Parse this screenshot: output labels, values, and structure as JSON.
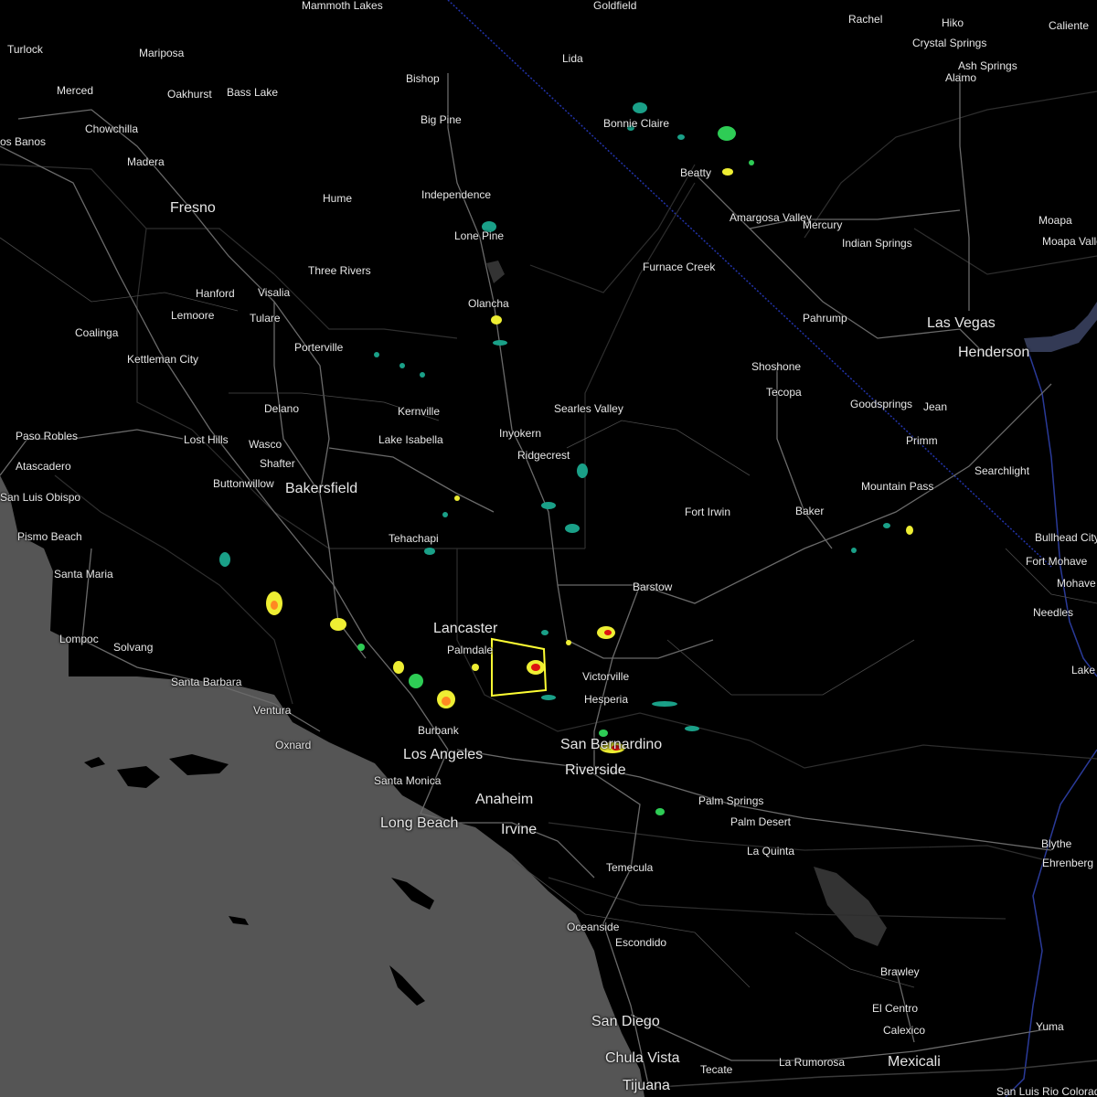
{
  "map": {
    "colors": {
      "land": "#000000",
      "ocean": "#555555",
      "roads": "#6e6e6e",
      "borders": "#3a3a3a",
      "state_line": "#2233aa",
      "water": "#333a55",
      "warning_polygon": "#ffff33",
      "radar_light": "#1aa088",
      "radar_mid": "#2ecc55",
      "radar_yellow": "#eeee33",
      "radar_orange": "#ff8822",
      "radar_red": "#dd1111"
    },
    "cities": [
      {
        "id": "turlock",
        "name": "Turlock"
      },
      {
        "id": "merced",
        "name": "Merced"
      },
      {
        "id": "mariposa",
        "name": "Mariposa"
      },
      {
        "id": "oakhurst",
        "name": "Oakhurst"
      },
      {
        "id": "bass-lake",
        "name": "Bass Lake"
      },
      {
        "id": "chowchilla",
        "name": "Chowchilla"
      },
      {
        "id": "los-banos",
        "name": "os Banos"
      },
      {
        "id": "madera",
        "name": "Madera"
      },
      {
        "id": "fresno",
        "name": "Fresno"
      },
      {
        "id": "hanford",
        "name": "Hanford"
      },
      {
        "id": "lemoore",
        "name": "Lemoore"
      },
      {
        "id": "visalia",
        "name": "Visalia"
      },
      {
        "id": "tulare",
        "name": "Tulare"
      },
      {
        "id": "coalinga",
        "name": "Coalinga"
      },
      {
        "id": "kettleman-city",
        "name": "Kettleman City"
      },
      {
        "id": "porterville",
        "name": "Porterville"
      },
      {
        "id": "three-rivers",
        "name": "Three Rivers"
      },
      {
        "id": "hume",
        "name": "Hume"
      },
      {
        "id": "delano",
        "name": "Delano"
      },
      {
        "id": "paso-robles",
        "name": "Paso Robles"
      },
      {
        "id": "lost-hills",
        "name": "Lost Hills"
      },
      {
        "id": "wasco",
        "name": "Wasco"
      },
      {
        "id": "shafter",
        "name": "Shafter"
      },
      {
        "id": "atascadero",
        "name": "Atascadero"
      },
      {
        "id": "buttonwillow",
        "name": "Buttonwillow"
      },
      {
        "id": "bakersfield",
        "name": "Bakersfield"
      },
      {
        "id": "san-luis-obispo",
        "name": "San Luis Obispo"
      },
      {
        "id": "pismo-beach",
        "name": "Pismo Beach"
      },
      {
        "id": "santa-maria",
        "name": "Santa Maria"
      },
      {
        "id": "lompoc",
        "name": "Lompoc"
      },
      {
        "id": "solvang",
        "name": "Solvang"
      },
      {
        "id": "santa-barbara",
        "name": "Santa Barbara"
      },
      {
        "id": "ventura",
        "name": "Ventura"
      },
      {
        "id": "oxnard",
        "name": "Oxnard"
      },
      {
        "id": "mammoth-lakes",
        "name": "Mammoth Lakes"
      },
      {
        "id": "bishop",
        "name": "Bishop"
      },
      {
        "id": "big-pine",
        "name": "Big Pine"
      },
      {
        "id": "independence",
        "name": "Independence"
      },
      {
        "id": "lone-pine",
        "name": "Lone Pine"
      },
      {
        "id": "olancha",
        "name": "Olancha"
      },
      {
        "id": "kernville",
        "name": "Kernville"
      },
      {
        "id": "lake-isabella",
        "name": "Lake Isabella"
      },
      {
        "id": "inyokern",
        "name": "Inyokern"
      },
      {
        "id": "ridgecrest",
        "name": "Ridgecrest"
      },
      {
        "id": "searles-valley",
        "name": "Searles Valley"
      },
      {
        "id": "tehachapi",
        "name": "Tehachapi"
      },
      {
        "id": "lancaster",
        "name": "Lancaster"
      },
      {
        "id": "palmdale",
        "name": "Palmdale"
      },
      {
        "id": "burbank",
        "name": "Burbank"
      },
      {
        "id": "los-angeles",
        "name": "Los Angeles"
      },
      {
        "id": "santa-monica",
        "name": "Santa Monica"
      },
      {
        "id": "long-beach",
        "name": "Long Beach"
      },
      {
        "id": "anaheim",
        "name": "Anaheim"
      },
      {
        "id": "irvine",
        "name": "Irvine"
      },
      {
        "id": "goldfield",
        "name": "Goldfield"
      },
      {
        "id": "lida",
        "name": "Lida"
      },
      {
        "id": "rachel",
        "name": "Rachel"
      },
      {
        "id": "hiko",
        "name": "Hiko"
      },
      {
        "id": "caliente",
        "name": "Caliente"
      },
      {
        "id": "crystal-springs",
        "name": "Crystal Springs"
      },
      {
        "id": "ash-springs",
        "name": "Ash Springs"
      },
      {
        "id": "alamo",
        "name": "Alamo"
      },
      {
        "id": "bonnie-claire",
        "name": "Bonnie Claire"
      },
      {
        "id": "beatty",
        "name": "Beatty"
      },
      {
        "id": "amargosa-valley",
        "name": "Amargosa Valley"
      },
      {
        "id": "mercury",
        "name": "Mercury"
      },
      {
        "id": "indian-springs",
        "name": "Indian Springs"
      },
      {
        "id": "moapa",
        "name": "Moapa"
      },
      {
        "id": "moapa-valley",
        "name": "Moapa Valley"
      },
      {
        "id": "furnace-creek",
        "name": "Furnace Creek"
      },
      {
        "id": "pahrump",
        "name": "Pahrump"
      },
      {
        "id": "las-vegas",
        "name": "Las Vegas"
      },
      {
        "id": "henderson",
        "name": "Henderson"
      },
      {
        "id": "shoshone",
        "name": "Shoshone"
      },
      {
        "id": "tecopa",
        "name": "Tecopa"
      },
      {
        "id": "goodsprings",
        "name": "Goodsprings"
      },
      {
        "id": "jean",
        "name": "Jean"
      },
      {
        "id": "primm",
        "name": "Primm"
      },
      {
        "id": "searchlight",
        "name": "Searchlight"
      },
      {
        "id": "mountain-pass",
        "name": "Mountain Pass"
      },
      {
        "id": "fort-irwin",
        "name": "Fort Irwin"
      },
      {
        "id": "baker",
        "name": "Baker"
      },
      {
        "id": "bullhead-city",
        "name": "Bullhead City"
      },
      {
        "id": "fort-mohave",
        "name": "Fort Mohave"
      },
      {
        "id": "mohave-valley",
        "name": "Mohave Valley"
      },
      {
        "id": "needles",
        "name": "Needles"
      },
      {
        "id": "barstow",
        "name": "Barstow"
      },
      {
        "id": "victorville",
        "name": "Victorville"
      },
      {
        "id": "hesperia",
        "name": "Hesperia"
      },
      {
        "id": "san-bernardino",
        "name": "San Bernardino"
      },
      {
        "id": "riverside",
        "name": "Riverside"
      },
      {
        "id": "palm-springs",
        "name": "Palm Springs"
      },
      {
        "id": "palm-desert",
        "name": "Palm Desert"
      },
      {
        "id": "la-quinta",
        "name": "La Quinta"
      },
      {
        "id": "temecula",
        "name": "Temecula"
      },
      {
        "id": "oceanside",
        "name": "Oceanside"
      },
      {
        "id": "escondido",
        "name": "Escondido"
      },
      {
        "id": "san-diego",
        "name": "San Diego"
      },
      {
        "id": "chula-vista",
        "name": "Chula Vista"
      },
      {
        "id": "tijuana",
        "name": "Tijuana"
      },
      {
        "id": "tecate",
        "name": "Tecate"
      },
      {
        "id": "la-rumorosa",
        "name": "La Rumorosa"
      },
      {
        "id": "mexicali",
        "name": "Mexicali"
      },
      {
        "id": "calexico",
        "name": "Calexico"
      },
      {
        "id": "el-centro",
        "name": "El Centro"
      },
      {
        "id": "brawley",
        "name": "Brawley"
      },
      {
        "id": "yuma",
        "name": "Yuma"
      },
      {
        "id": "blythe",
        "name": "Blythe"
      },
      {
        "id": "ehrenberg",
        "name": "Ehrenberg"
      },
      {
        "id": "san-luis-rio-colorado",
        "name": "San Luis Rio Colorado"
      },
      {
        "id": "lake-havasu",
        "name": "Lake Hava"
      }
    ]
  }
}
